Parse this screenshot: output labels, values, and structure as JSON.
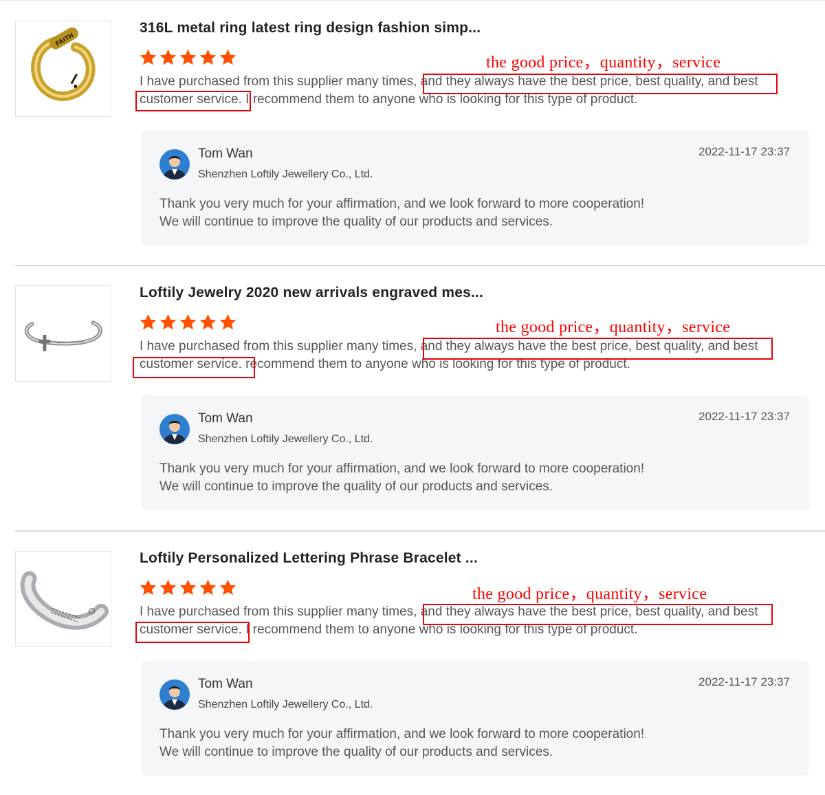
{
  "colors": {
    "star": "#ff5000",
    "annotation": "#ff0000",
    "highlight_box": "#e8000b"
  },
  "reviews": [
    {
      "product_title": "316L metal ring latest ring design fashion simp...",
      "product_image": "gold-ring-image",
      "rating": 5,
      "annotation": "the good price，quantity，service",
      "text": {
        "line1_pre": "I have purchased from this supplier many times,",
        "line1_hl": "and they always have the best price, best quality, and best",
        "line2_hl": "customer service.",
        "line2_post": "I recommend them to anyone who is looking for this type of product."
      },
      "reply": {
        "name": "Tom Wan",
        "company": "Shenzhen Loftily Jewellery Co., Ltd.",
        "date": "2022-11-17 23:37",
        "line1": "Thank you very much for your affirmation, and we look forward to more cooperation!",
        "line2": "We will continue to improve the quality of our products and services."
      }
    },
    {
      "product_title": "Loftily Jewelry 2020 new arrivals engraved mes...",
      "product_image": "cross-bangle-image",
      "rating": 5,
      "annotation": "the good price，quantity，service",
      "text": {
        "line1_pre": "I have purchased from this supplier many times,",
        "line1_hl": "and they always have the best price, best quality, and best",
        "line2_hl": "customer service.",
        "line2_post": "recommend them to anyone who is looking for this type of product."
      },
      "reply": {
        "name": "Tom Wan",
        "company": "Shenzhen Loftily Jewellery Co., Ltd.",
        "date": "2022-11-17 23:37",
        "line1": "Thank you very much for your affirmation, and we look forward to more cooperation!",
        "line2": "We will continue to improve the quality of our products and services."
      }
    },
    {
      "product_title": "Loftily Personalized Lettering Phrase Bracelet ...",
      "product_image": "engraved-cuff-image",
      "rating": 5,
      "annotation": "the good price，quantity，service",
      "text": {
        "line1_pre": "I have purchased from this supplier many times,",
        "line1_hl": "and they always have the best price, best quality, and best",
        "line2_hl": "customer service.",
        "line2_post": "I recommend them to anyone who is looking for this type of product."
      },
      "reply": {
        "name": "Tom Wan",
        "company": "Shenzhen Loftily Jewellery Co., Ltd.",
        "date": "2022-11-17 23:37",
        "line1": "Thank you very much for your affirmation, and we look forward to more cooperation!",
        "line2": "We will continue to improve the quality of our products and services."
      }
    }
  ]
}
